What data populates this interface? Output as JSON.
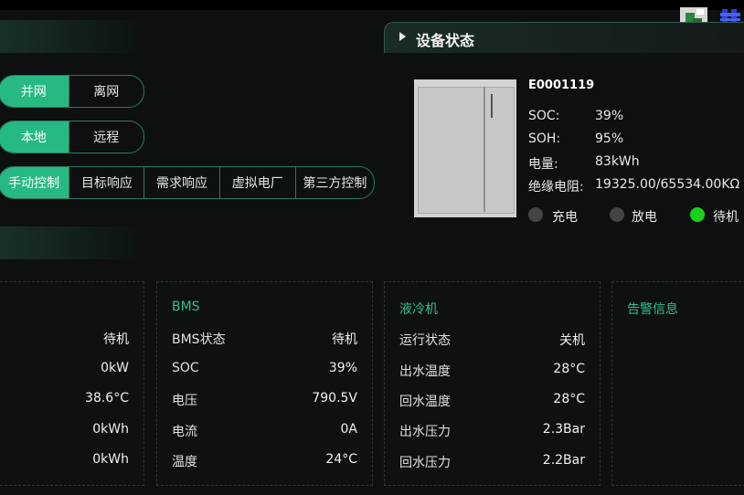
{
  "device_panel": {
    "title": "设备状态"
  },
  "mode_grid": {
    "options": [
      "并网",
      "离网"
    ],
    "active": 0
  },
  "mode_local": {
    "options": [
      "本地",
      "远程"
    ],
    "active": 0
  },
  "mode_control": {
    "options": [
      "手动控制",
      "目标响应",
      "需求响应",
      "虚拟电厂",
      "第三方控制"
    ],
    "active": 0
  },
  "device": {
    "id": "E0001119",
    "fields": [
      {
        "label": "SOC:",
        "value": "39%"
      },
      {
        "label": "SOH:",
        "value": "95%"
      },
      {
        "label": "电量:",
        "value": "83kWh"
      },
      {
        "label": "绝缘电阻:",
        "value": "19325.00/65534.00KΩ"
      }
    ],
    "states": [
      {
        "label": "充电",
        "color": "#444444"
      },
      {
        "label": "放电",
        "color": "#444444"
      },
      {
        "label": "待机",
        "color": "#1bd11b"
      }
    ]
  },
  "pcs_card": {
    "rows": [
      {
        "value": "待机"
      },
      {
        "value": "0kW"
      },
      {
        "value": "38.6°C"
      },
      {
        "value": "0kWh"
      },
      {
        "value": "0kWh"
      }
    ]
  },
  "bms_card": {
    "title": "BMS",
    "rows": [
      {
        "label": "BMS状态",
        "value": "待机"
      },
      {
        "label": "SOC",
        "value": "39%"
      },
      {
        "label": "电压",
        "value": "790.5V"
      },
      {
        "label": "电流",
        "value": "0A"
      },
      {
        "label": "温度",
        "value": "24°C"
      }
    ]
  },
  "cooler_card": {
    "title": "液冷机",
    "rows": [
      {
        "label": "运行状态",
        "value": "关机"
      },
      {
        "label": "出水温度",
        "value": "28°C"
      },
      {
        "label": "回水温度",
        "value": "28°C"
      },
      {
        "label": "出水压力",
        "value": "2.3Bar"
      },
      {
        "label": "回水压力",
        "value": "2.2Bar"
      }
    ]
  },
  "alarm_card": {
    "title": "告警信息"
  }
}
